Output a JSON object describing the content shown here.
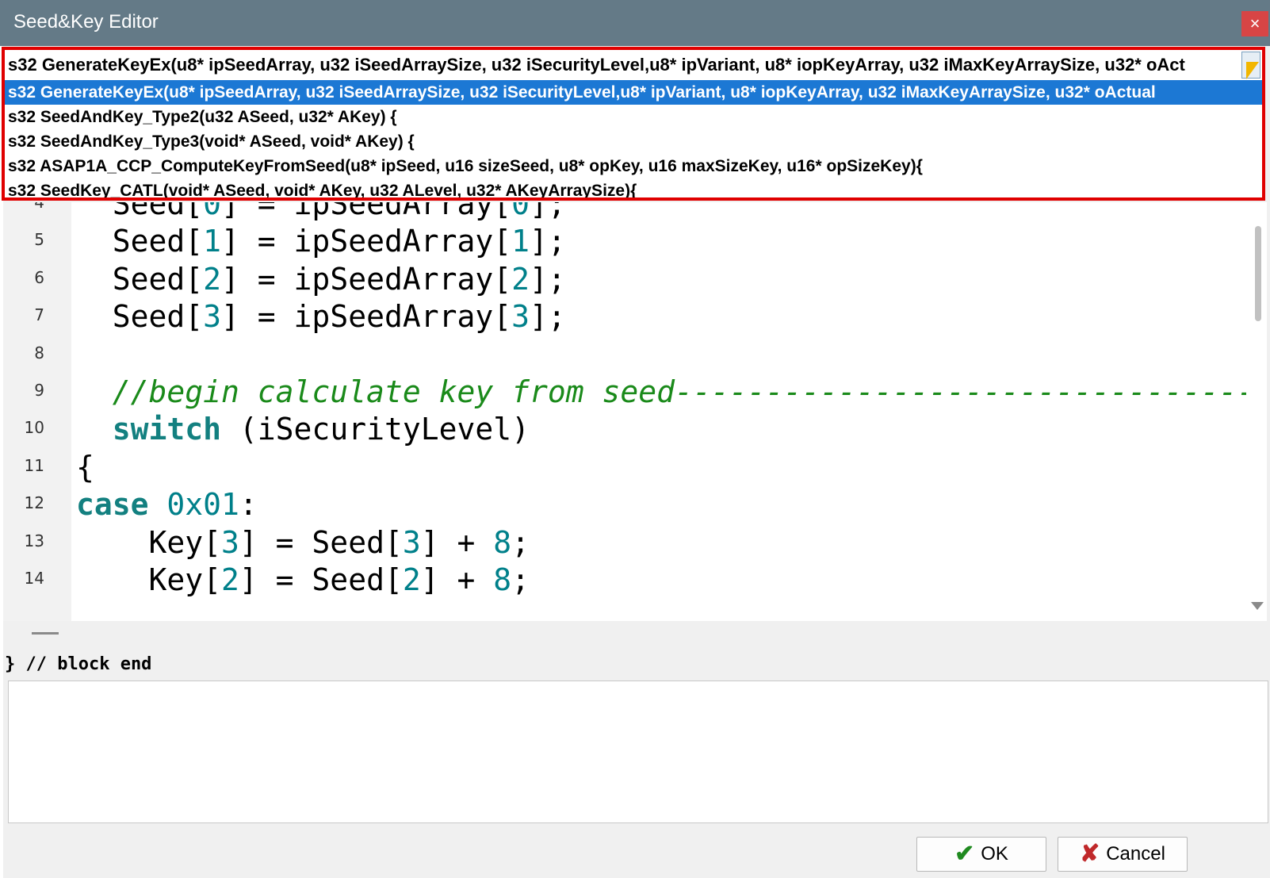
{
  "window": {
    "title": "Seed&Key Editor",
    "close_glyph": "×"
  },
  "combo": {
    "selected_text": "s32 GenerateKeyEx(u8* ipSeedArray, u32 iSeedArraySize, u32 iSecurityLevel,u8* ipVariant, u8* iopKeyArray, u32 iMaxKeyArraySize, u32* oAct",
    "options": [
      "s32 GenerateKeyEx(u8* ipSeedArray, u32 iSeedArraySize, u32 iSecurityLevel,u8* ipVariant, u8* iopKeyArray, u32 iMaxKeyArraySize, u32* oActual",
      "s32 SeedAndKey_Type2(u32 ASeed, u32* AKey) {",
      "s32 SeedAndKey_Type3(void* ASeed, void* AKey) {",
      "s32 ASAP1A_CCP_ComputeKeyFromSeed(u8* ipSeed, u16 sizeSeed, u8* opKey, u16 maxSizeKey, u16* opSizeKey){",
      "s32 SeedKey_CATL(void* ASeed, void* AKey, u32 ALevel, u32* AKeyArraySize){"
    ],
    "highlight_color": "#1c78d4",
    "border_color": "#e00000"
  },
  "editor": {
    "lines": [
      {
        "n": "4",
        "parts": [
          [
            "  Seed[",
            ""
          ],
          [
            "0",
            "num"
          ],
          [
            "] = ipSeedArray[",
            ""
          ],
          [
            "0",
            "num"
          ],
          [
            "];",
            ""
          ]
        ]
      },
      {
        "n": "5",
        "parts": [
          [
            "  Seed[",
            ""
          ],
          [
            "1",
            "num"
          ],
          [
            "] = ipSeedArray[",
            ""
          ],
          [
            "1",
            "num"
          ],
          [
            "];",
            ""
          ]
        ]
      },
      {
        "n": "6",
        "parts": [
          [
            "  Seed[",
            ""
          ],
          [
            "2",
            "num"
          ],
          [
            "] = ipSeedArray[",
            ""
          ],
          [
            "2",
            "num"
          ],
          [
            "];",
            ""
          ]
        ]
      },
      {
        "n": "7",
        "parts": [
          [
            "  Seed[",
            ""
          ],
          [
            "3",
            "num"
          ],
          [
            "] = ipSeedArray[",
            ""
          ],
          [
            "3",
            "num"
          ],
          [
            "];",
            ""
          ]
        ]
      },
      {
        "n": "8",
        "parts": []
      },
      {
        "n": "9",
        "parts": [
          [
            "  ",
            ""
          ],
          [
            "//begin calculate key from seed------------------------------------",
            "cm"
          ]
        ]
      },
      {
        "n": "10",
        "parts": [
          [
            "  ",
            ""
          ],
          [
            "switch",
            "kw"
          ],
          [
            " (iSecurityLevel)",
            ""
          ]
        ]
      },
      {
        "n": "11",
        "parts": [
          [
            "{",
            ""
          ]
        ]
      },
      {
        "n": "12",
        "parts": [
          [
            "case",
            "kw"
          ],
          [
            " ",
            ""
          ],
          [
            "0x01",
            "num"
          ],
          [
            ":",
            ""
          ]
        ]
      },
      {
        "n": "13",
        "parts": [
          [
            "    Key[",
            ""
          ],
          [
            "3",
            "num"
          ],
          [
            "] = Seed[",
            ""
          ],
          [
            "3",
            "num"
          ],
          [
            "] + ",
            ""
          ],
          [
            "8",
            "num"
          ],
          [
            ";",
            ""
          ]
        ]
      },
      {
        "n": "14",
        "parts": [
          [
            "    Key[",
            ""
          ],
          [
            "2",
            "num"
          ],
          [
            "] = Seed[",
            ""
          ],
          [
            "2",
            "num"
          ],
          [
            "] + ",
            ""
          ],
          [
            "8",
            "num"
          ],
          [
            ";",
            ""
          ]
        ]
      }
    ],
    "colors": {
      "number": "#00808a",
      "keyword": "#138080",
      "comment": "#1a8a1a"
    }
  },
  "status": {
    "block_end": "} // block end"
  },
  "output": {
    "text": ""
  },
  "buttons": {
    "ok_label": "OK",
    "ok_glyph": "✔",
    "cancel_label": "Cancel",
    "cancel_glyph": "✘"
  }
}
